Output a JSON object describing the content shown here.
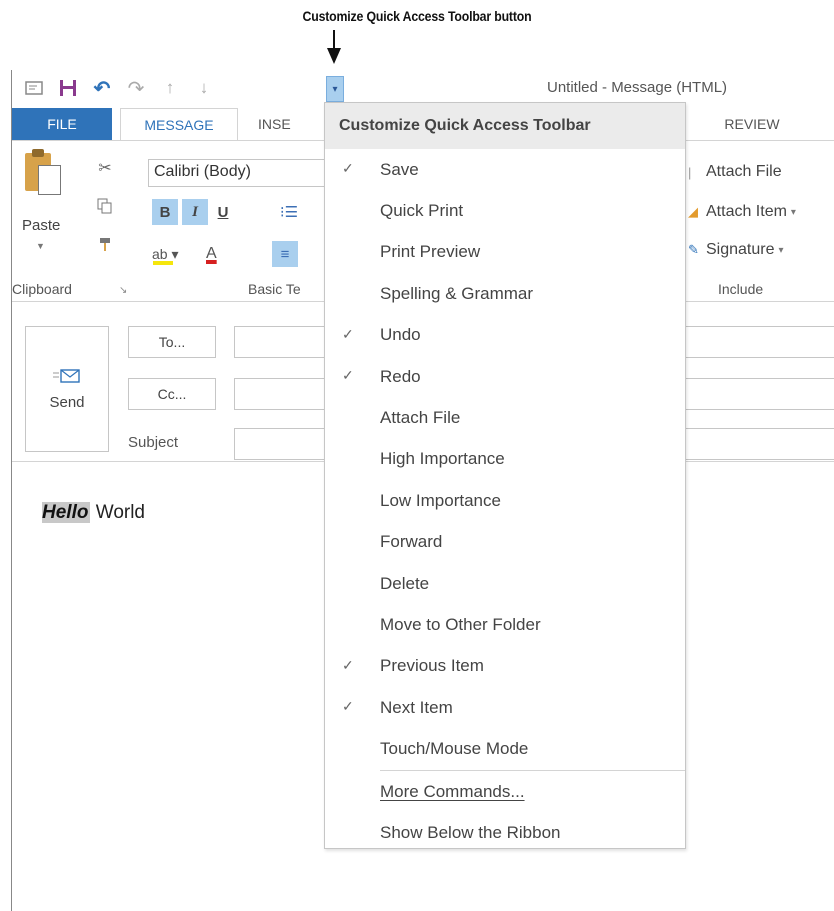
{
  "callout": "Customize Quick Access Toolbar button",
  "window": {
    "title": "Untitled - Message (HTML)"
  },
  "qat": {
    "icons": [
      "message-icon",
      "save-icon",
      "undo-icon",
      "redo-icon",
      "previous-item-icon",
      "next-item-icon",
      "customize-dropdown-icon"
    ]
  },
  "tabs": {
    "file": "FILE",
    "message": "MESSAGE",
    "insert": "INSE",
    "review": "REVIEW"
  },
  "ribbon": {
    "paste": "Paste",
    "font_name": "Calibri (Body)",
    "bold": "B",
    "italic": "I",
    "underline": "U",
    "highlight": "ab",
    "font_color": "A",
    "group_clipboard": "Clipboard",
    "group_basic_text": "Basic Te",
    "group_include": "Include",
    "include_items": [
      "Attach File",
      "Attach Item",
      "Signature"
    ]
  },
  "form": {
    "send": "Send",
    "to": "To...",
    "cc": "Cc...",
    "subject": "Subject"
  },
  "body": {
    "hello": "Hello",
    "world": " World"
  },
  "menu": {
    "header": "Customize Quick Access Toolbar",
    "items": [
      {
        "label": "Save",
        "checked": true
      },
      {
        "label": "Quick Print",
        "checked": false
      },
      {
        "label": "Print Preview",
        "checked": false
      },
      {
        "label": "Spelling & Grammar",
        "checked": false
      },
      {
        "label": "Undo",
        "checked": true
      },
      {
        "label": "Redo",
        "checked": true
      },
      {
        "label": "Attach File",
        "checked": false
      },
      {
        "label": "High Importance",
        "checked": false
      },
      {
        "label": "Low Importance",
        "checked": false
      },
      {
        "label": "Forward",
        "checked": false
      },
      {
        "label": "Delete",
        "checked": false
      },
      {
        "label": "Move to Other Folder",
        "checked": false
      },
      {
        "label": "Previous Item",
        "checked": true
      },
      {
        "label": "Next Item",
        "checked": true
      },
      {
        "label": "Touch/Mouse Mode",
        "checked": false
      }
    ],
    "more_commands": "More Commands...",
    "show_below": "Show Below the Ribbon",
    "check_glyph": "✓"
  },
  "colors": {
    "accent": "#2f73b9",
    "selected": "#a9cfee"
  }
}
